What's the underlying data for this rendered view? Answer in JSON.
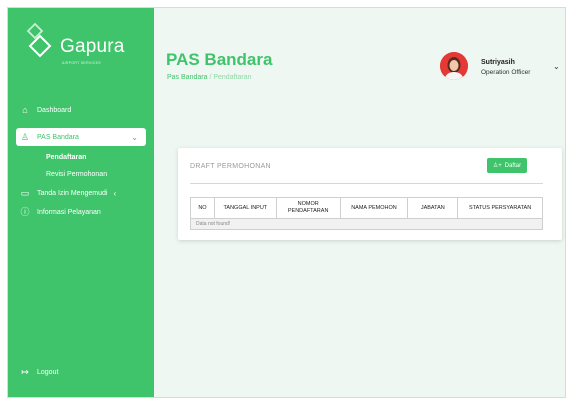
{
  "logo": {
    "name": "Gapura",
    "tagline": "AIRPORT SERVICES"
  },
  "sidebar": {
    "items": [
      {
        "label": "Dashboard",
        "icon": "home-icon"
      },
      {
        "label": "PAS Bandara",
        "icon": "user-icon",
        "active": true
      },
      {
        "label": "Tanda Izin Mengemudi",
        "icon": "card-icon"
      },
      {
        "label": "Informasi Pelayanan",
        "icon": "info-icon"
      }
    ],
    "subitems": [
      "Pendaftaran",
      "Revisi Permohonan"
    ],
    "logout": "Logout"
  },
  "header": {
    "title": "PAS Bandara",
    "breadcrumb": {
      "root": "Pas Bandara",
      "separator": "/",
      "current": "Pendaftaran"
    }
  },
  "user": {
    "name": "Sutriyasih",
    "role": "Operation Officer"
  },
  "card": {
    "title": "DRAFT PERMOHONAN",
    "daftar_label": "Daftar",
    "columns": [
      "NO",
      "TANGGAL INPUT",
      "NOMOR PENDAFTARAN",
      "NAMA PEMOHON",
      "JABATAN",
      "STATUS PERSYARATAN"
    ],
    "empty_text": "Data not found!"
  },
  "colors": {
    "primary": "#3fc46b",
    "background": "#eef7f1"
  }
}
